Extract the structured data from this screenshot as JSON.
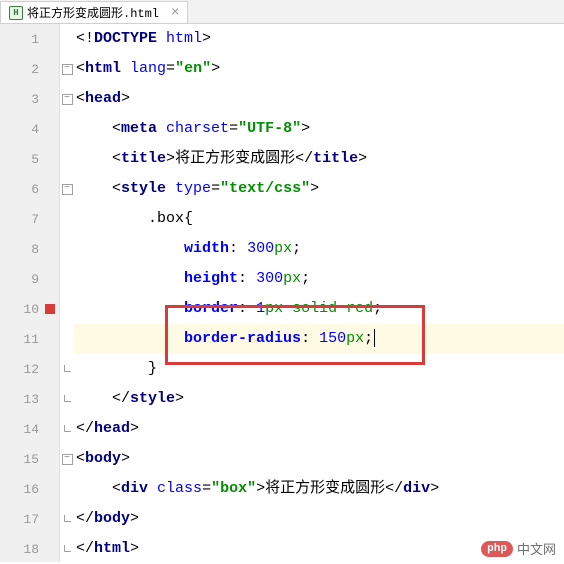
{
  "tab": {
    "label": "将正方形变成圆形.html"
  },
  "gutter": [
    "1",
    "2",
    "3",
    "4",
    "5",
    "6",
    "7",
    "8",
    "9",
    "10",
    "11",
    "12",
    "13",
    "14",
    "15",
    "16",
    "17",
    "18"
  ],
  "code": {
    "l1": {
      "pre": "<!",
      "tag": "DOCTYPE ",
      "attr": "html",
      "post": ">"
    },
    "l2": {
      "o1": "<",
      "tag": "html ",
      "attr": "lang",
      "eq": "=",
      "q1": "\"",
      "val": "en",
      "q2": "\"",
      "c": ">"
    },
    "l3": {
      "o1": "<",
      "tag": "head",
      "c": ">"
    },
    "l4": {
      "o1": "<",
      "tag": "meta ",
      "attr": "charset",
      "eq": "=",
      "q1": "\"",
      "val": "UTF-8",
      "q2": "\"",
      "c": ">"
    },
    "l5": {
      "o1": "<",
      "tag1": "title",
      "c1": ">",
      "text": "将正方形变成圆形",
      "o2": "</",
      "tag2": "title",
      "c2": ">"
    },
    "l6": {
      "o1": "<",
      "tag": "style ",
      "attr": "type",
      "eq": "=",
      "q1": "\"",
      "val": "text/css",
      "q2": "\"",
      "c": ">"
    },
    "l7": {
      "sel": ".box",
      "brace": "{"
    },
    "l8": {
      "prop": "width",
      "colon": ": ",
      "num": "300",
      "unit": "px",
      "semi": ";"
    },
    "l9": {
      "prop": "height",
      "colon": ": ",
      "num": "300",
      "unit": "px",
      "semi": ";"
    },
    "l10": {
      "prop": "border",
      "colon": ": ",
      "num": "1",
      "unit": "px",
      "sp": " ",
      "w1": "solid",
      "sp2": " ",
      "w2": "red",
      "semi": ";"
    },
    "l11": {
      "prop": "border-radius",
      "colon": ": ",
      "num": "150",
      "unit": "px",
      "semi": ";"
    },
    "l12": {
      "brace": "}"
    },
    "l13": {
      "o1": "</",
      "tag": "style",
      "c": ">"
    },
    "l14": {
      "o1": "</",
      "tag": "head",
      "c": ">"
    },
    "l15": {
      "o1": "<",
      "tag": "body",
      "c": ">"
    },
    "l16": {
      "o1": "<",
      "tag1": "div ",
      "attr": "class",
      "eq": "=",
      "q1": "\"",
      "val": "box",
      "q2": "\"",
      "c1": ">",
      "text": "将正方形变成圆形",
      "o2": "</",
      "tag2": "div",
      "c2": ">"
    },
    "l17": {
      "o1": "</",
      "tag": "body",
      "c": ">"
    },
    "l18": {
      "o1": "</",
      "tag": "html",
      "c": ">"
    }
  },
  "watermark": {
    "badge": "php",
    "text": "中文网"
  },
  "chart_data": null
}
